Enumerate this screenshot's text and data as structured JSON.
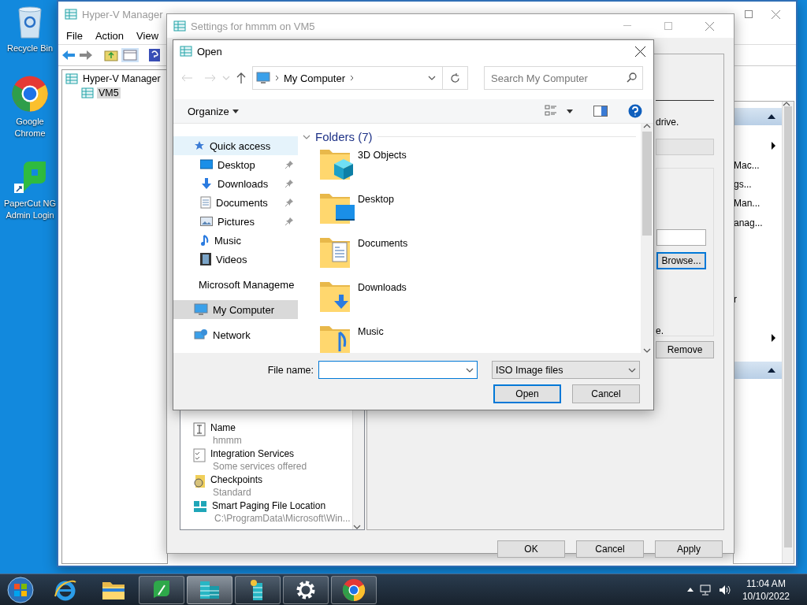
{
  "desktop": {
    "icons": [
      {
        "kind": "recycle",
        "label": "Recycle Bin"
      },
      {
        "kind": "chrome",
        "label": "Google Chrome"
      },
      {
        "kind": "papercut",
        "label": "PaperCut NG Admin Login"
      }
    ]
  },
  "hyperv": {
    "title": "Hyper-V Manager",
    "menu": [
      "File",
      "Action",
      "View"
    ],
    "tree": [
      {
        "label": "Hyper-V Manager",
        "selected": false,
        "children": [
          {
            "label": "VM5",
            "selected": true
          }
        ]
      }
    ],
    "action_sections": [
      {
        "expanded": true,
        "rows": [
          {
            "submenu": true
          },
          {
            "text": "Mac...",
            "submenu": false
          },
          {
            "text": "gs...",
            "submenu": false
          },
          {
            "text": "Man...",
            "submenu": false
          },
          {
            "text": "anag...",
            "submenu": false
          },
          {
            "submenu": false
          },
          {
            "submenu": false
          },
          {
            "submenu": false
          },
          {
            "text": "r",
            "submenu": false
          },
          {
            "submenu": false
          },
          {
            "submenu": true
          }
        ]
      },
      {
        "expanded": true
      }
    ]
  },
  "settings": {
    "title": "Settings for hmmm on VM5",
    "items": [
      {
        "kind": "name",
        "label": "Name",
        "value": "hmmm"
      },
      {
        "kind": "integration",
        "label": "Integration Services",
        "value": "Some services offered"
      },
      {
        "kind": "checkpoint",
        "label": "Checkpoints",
        "value": "Standard"
      },
      {
        "kind": "paging",
        "label": "Smart Paging File Location",
        "value": "C:\\ProgramData\\Microsoft\\Win..."
      }
    ],
    "detail": {
      "text_top": "drive.",
      "browse": "Browse...",
      "text_bottom": "e.",
      "remove": "Remove"
    },
    "buttons": [
      "OK",
      "Cancel",
      "Apply"
    ]
  },
  "open_dialog": {
    "title": "Open",
    "path": "My Computer",
    "search_placeholder": "Search My Computer",
    "organize": "Organize",
    "nav": [
      {
        "label": "Quick access",
        "kind": "star",
        "selected": false,
        "hovered": true,
        "children": [
          {
            "label": "Desktop",
            "kind": "desktop",
            "pinned": true,
            "selected": false,
            "hovered": false
          },
          {
            "label": "Downloads",
            "kind": "downloads",
            "pinned": true,
            "selected": false,
            "hovered": false
          },
          {
            "label": "Documents",
            "kind": "documents",
            "pinned": true,
            "selected": false,
            "hovered": false
          },
          {
            "label": "Pictures",
            "kind": "pictures",
            "pinned": true,
            "selected": false,
            "hovered": false
          },
          {
            "label": "Music",
            "kind": "music",
            "pinned": false,
            "selected": false,
            "hovered": false
          },
          {
            "label": "Videos",
            "kind": "videos",
            "pinned": false,
            "selected": false,
            "hovered": false
          }
        ]
      },
      {
        "label": "Microsoft Manageme",
        "kind": "mmc",
        "selected": false,
        "hovered": false
      },
      {
        "label": "My Computer",
        "kind": "computer",
        "selected": true,
        "hovered": false
      },
      {
        "label": "Network",
        "kind": "network",
        "selected": false,
        "hovered": false
      }
    ],
    "group": {
      "label": "Folders (7)",
      "expanded": true
    },
    "folders": [
      {
        "label": "3D Objects",
        "kind": "objects"
      },
      {
        "label": "Desktop",
        "kind": "desktop"
      },
      {
        "label": "Documents",
        "kind": "documents"
      },
      {
        "label": "Downloads",
        "kind": "downloads"
      },
      {
        "label": "Music",
        "kind": "music"
      }
    ],
    "file_name_label": "File name:",
    "file_type": "ISO Image files",
    "buttons": [
      {
        "label": "Open",
        "default": true
      },
      {
        "label": "Cancel",
        "default": false
      }
    ]
  },
  "taskbar": {
    "apps": [
      {
        "kind": "ie",
        "running": false,
        "selected": false
      },
      {
        "kind": "explorer",
        "running": false,
        "selected": false
      },
      {
        "kind": "papercut",
        "running": true,
        "selected": false
      },
      {
        "kind": "hyperv",
        "running": true,
        "selected": true
      },
      {
        "kind": "server",
        "running": true,
        "selected": false
      },
      {
        "kind": "settings",
        "running": true,
        "selected": false
      },
      {
        "kind": "chrome",
        "running": true,
        "selected": false
      }
    ],
    "time": "11:04 AM",
    "date": "10/10/2022"
  }
}
